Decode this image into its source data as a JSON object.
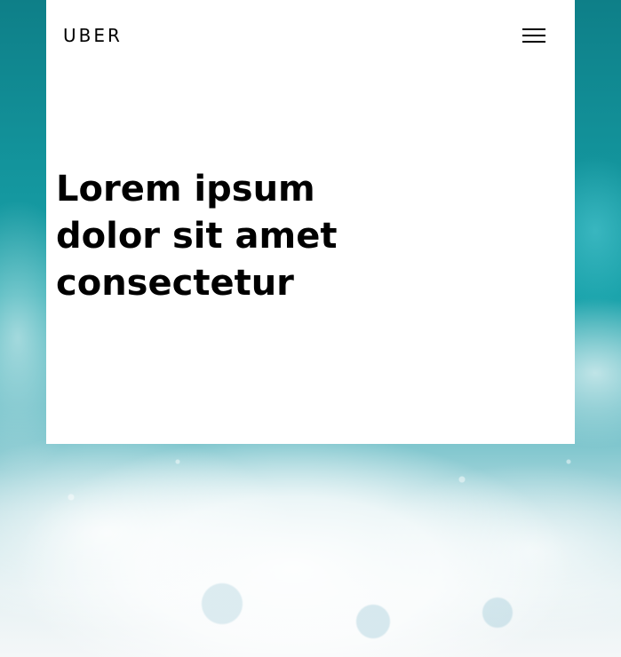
{
  "header": {
    "logo_text": "UBER",
    "menu_icon": "hamburger-menu-icon"
  },
  "hero": {
    "headline": "Lorem ipsum dolor sit amet consectetur"
  },
  "background": {
    "description_colors": {
      "deep_teal": "#0e7f88",
      "turquoise": "#1aa3ab",
      "foam_white": "#f4f7f8"
    }
  }
}
